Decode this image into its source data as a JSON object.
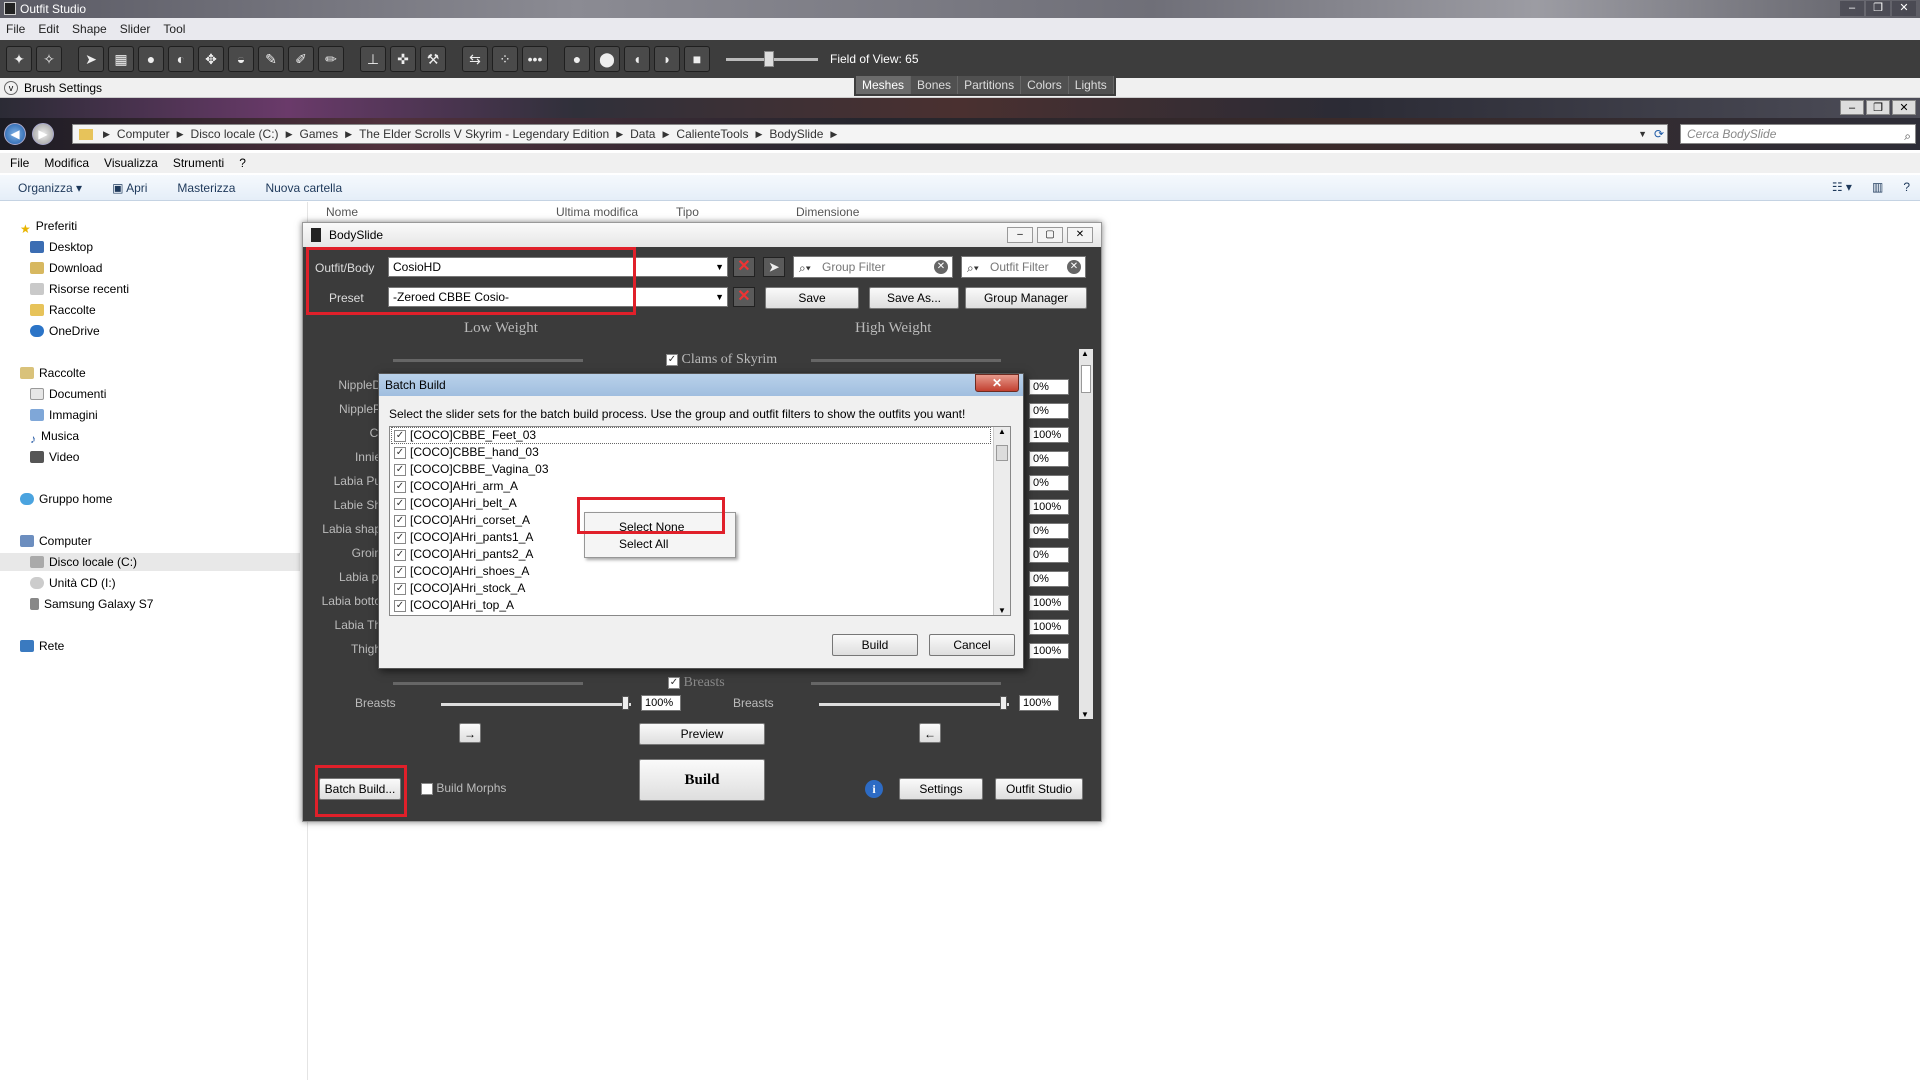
{
  "outfit_studio": {
    "title": "Outfit Studio",
    "menu": [
      "File",
      "Edit",
      "Shape",
      "Slider",
      "Tool"
    ],
    "field_of_view": "Field of View: 65",
    "fov_value": 65,
    "brush_settings": "Brush Settings",
    "tabs": [
      "Meshes",
      "Bones",
      "Partitions",
      "Colors",
      "Lights"
    ],
    "active_tab": "Meshes"
  },
  "explorer": {
    "breadcrumb": [
      "Computer",
      "Disco locale (C:)",
      "Games",
      "The Elder Scrolls V Skyrim - Legendary Edition",
      "Data",
      "CalienteTools",
      "BodySlide"
    ],
    "search_placeholder": "Cerca BodySlide",
    "menu": [
      "File",
      "Modifica",
      "Visualizza",
      "Strumenti",
      "?"
    ],
    "commands": [
      "Organizza",
      "Apri",
      "Masterizza",
      "Nuova cartella"
    ],
    "columns": [
      "Nome",
      "Ultima modifica",
      "Tipo",
      "Dimensione"
    ],
    "nav": {
      "favorites": "Preferiti",
      "favorite_items": [
        "Desktop",
        "Download",
        "Risorse recenti",
        "Raccolte",
        "OneDrive"
      ],
      "libraries": "Raccolte",
      "library_items": [
        "Documenti",
        "Immagini",
        "Musica",
        "Video"
      ],
      "homegroup": "Gruppo home",
      "computer": "Computer",
      "computer_items": [
        "Disco locale (C:)",
        "Unità CD (I:)",
        "Samsung Galaxy S7"
      ],
      "network": "Rete"
    }
  },
  "bodyslide": {
    "title": "BodySlide",
    "outfit_label": "Outfit/Body",
    "outfit_value": "CosioHD",
    "preset_label": "Preset",
    "preset_value": "-Zeroed CBBE Cosio-",
    "group_filter": "Group Filter",
    "outfit_filter": "Outfit Filter",
    "save": "Save",
    "save_as": "Save As...",
    "group_manager": "Group Manager",
    "low_weight": "Low Weight",
    "high_weight": "High Weight",
    "category_clams": "Clams of Skyrim",
    "category_breasts": "Breasts",
    "slider_labels": [
      "NippleD",
      "NippleP",
      "Cl",
      "Innie",
      "Labia Pu",
      "Labie Sh",
      "Labia shap",
      "Groin",
      "Labia pi",
      "Labia botto",
      "Labia Th",
      "Thigh"
    ],
    "right_values": [
      "0%",
      "0%",
      "100%",
      "0%",
      "0%",
      "100%",
      "0%",
      "0%",
      "0%",
      "100%",
      "100%",
      "100%"
    ],
    "breasts_label": "Breasts",
    "breasts_low": "100%",
    "breasts_high": "100%",
    "preview": "Preview",
    "build": "Build",
    "batch_build": "Batch Build...",
    "build_morphs": "Build Morphs",
    "settings": "Settings",
    "outfit_studio": "Outfit Studio"
  },
  "batch_dialog": {
    "title": "Batch Build",
    "instructions": "Select the slider sets for the batch build process. Use the group and outfit filters to show the outfits you want!",
    "items": [
      "[COCO]CBBE_Feet_03",
      "[COCO]CBBE_hand_03",
      "[COCO]CBBE_Vagina_03",
      "[COCO]AHri_arm_A",
      "[COCO]AHri_belt_A",
      "[COCO]AHri_corset_A",
      "[COCO]AHri_pants1_A",
      "[COCO]AHri_pants2_A",
      "[COCO]AHri_shoes_A",
      "[COCO]AHri_stock_A",
      "[COCO]AHri_top_A"
    ],
    "build": "Build",
    "cancel": "Cancel"
  },
  "context_menu": {
    "select_none": "Select None",
    "select_all": "Select All"
  },
  "colors": {
    "highlight": "#e0202a",
    "bodyslide_bg": "#3b3b3b"
  }
}
